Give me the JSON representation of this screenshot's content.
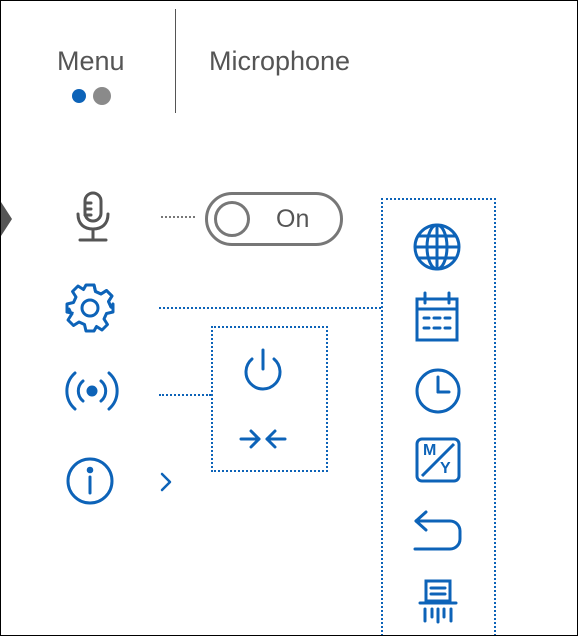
{
  "header": {
    "menu_label": "Menu",
    "section_label": "Microphone",
    "page_dots": {
      "count": 2,
      "active_index": 0
    }
  },
  "microphone": {
    "toggle_label": "On",
    "state": "on"
  },
  "icons": {
    "side": [
      "microphone-icon",
      "gear-icon",
      "wifi-signal-icon",
      "info-icon"
    ],
    "info_submenu_arrow": "chevron-right-icon",
    "wifi_submenu": [
      "power-icon",
      "reset-compress-icon"
    ],
    "settings_submenu": [
      "globe-icon",
      "calendar-icon",
      "clock-icon",
      "date-format-icon",
      "back-return-icon",
      "shredder-icon"
    ],
    "selection_marker": "triangle-pointer-icon"
  },
  "date_format_icon_letters": {
    "top": "M",
    "bottom": "Y"
  },
  "colors": {
    "accent_blue": "#0d63b8",
    "text_gray": "#555555",
    "dot_active": "#0d63b8",
    "dot_inactive": "#8a8a8a",
    "pointer_gray": "#555555"
  }
}
